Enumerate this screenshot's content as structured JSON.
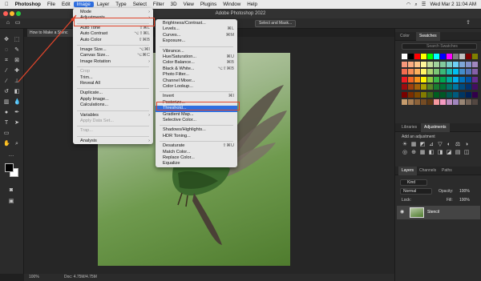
{
  "menubar": {
    "apple": "",
    "items": [
      "Photoshop",
      "File",
      "Edit",
      "Image",
      "Layer",
      "Type",
      "Select",
      "Filter",
      "3D",
      "View",
      "Plugins",
      "Window",
      "Help"
    ],
    "active": "Image",
    "clock": "Wed Mar 2  11:04 AM"
  },
  "titlebar": {
    "title": "Adobe Photoshop 2022"
  },
  "optionsbar": {
    "select_and_mask": "Select and Mask..."
  },
  "document": {
    "tab": "How to Make a Stenc",
    "zoom": "100%",
    "doc_info": "Doc: 4.75M/4.75M"
  },
  "image_menu": {
    "items": [
      {
        "label": "Mode",
        "arrow": "›"
      },
      {
        "label": "Adjustments",
        "arrow": "›"
      },
      {
        "label": "Auto Tone",
        "shortcut": "⇧⌘L"
      },
      {
        "label": "Auto Contrast",
        "shortcut": "⌥⇧⌘L"
      },
      {
        "label": "Auto Color",
        "shortcut": "⇧⌘B"
      },
      {
        "label": "Image Size...",
        "shortcut": "⌥⌘I"
      },
      {
        "label": "Canvas Size...",
        "shortcut": "⌥⌘C"
      },
      {
        "label": "Image Rotation",
        "arrow": "›"
      },
      {
        "label": "Crop",
        "disabled": true
      },
      {
        "label": "Trim..."
      },
      {
        "label": "Reveal All"
      },
      {
        "label": "Duplicate..."
      },
      {
        "label": "Apply Image..."
      },
      {
        "label": "Calculations..."
      },
      {
        "label": "Variables",
        "arrow": "›"
      },
      {
        "label": "Apply Data Set...",
        "disabled": true
      },
      {
        "label": "Trap...",
        "disabled": true
      },
      {
        "label": "Analysis",
        "arrow": "›"
      }
    ]
  },
  "adjustments_menu": {
    "items": [
      {
        "label": "Brightness/Contrast..."
      },
      {
        "label": "Levels...",
        "shortcut": "⌘L"
      },
      {
        "label": "Curves...",
        "shortcut": "⌘M"
      },
      {
        "label": "Exposure..."
      },
      {
        "label": "Vibrance..."
      },
      {
        "label": "Hue/Saturation...",
        "shortcut": "⌘U"
      },
      {
        "label": "Color Balance...",
        "shortcut": "⌘B"
      },
      {
        "label": "Black & White...",
        "shortcut": "⌥⇧⌘B"
      },
      {
        "label": "Photo Filter..."
      },
      {
        "label": "Channel Mixer..."
      },
      {
        "label": "Color Lookup..."
      },
      {
        "label": "Invert",
        "shortcut": "⌘I"
      },
      {
        "label": "Posterize..."
      },
      {
        "label": "Threshold...",
        "highlighted": true
      },
      {
        "label": "Gradient Map..."
      },
      {
        "label": "Selective Color..."
      },
      {
        "label": "Shadows/Highlights..."
      },
      {
        "label": "HDR Toning..."
      },
      {
        "label": "Desaturate",
        "shortcut": "⇧⌘U"
      },
      {
        "label": "Match Color..."
      },
      {
        "label": "Replace Color..."
      },
      {
        "label": "Equalize"
      }
    ]
  },
  "panels": {
    "color_tabs": [
      "Color",
      "Swatches"
    ],
    "search_placeholder": "Search Swatches",
    "lib_tabs": [
      "Libraries",
      "Adjustments"
    ],
    "add_adjustment": "Add an adjustment",
    "layers_tabs": [
      "Layers",
      "Channels",
      "Paths"
    ],
    "kind": "Kind",
    "blend_mode": "Normal",
    "opacity_label": "Opacity:",
    "opacity": "100%",
    "lock_label": "Lock:",
    "fill_label": "Fill:",
    "fill": "100%",
    "layer_name": "Stencil"
  },
  "colors": {
    "accent": "#2f6fe0",
    "annotation": "#e0452b"
  }
}
